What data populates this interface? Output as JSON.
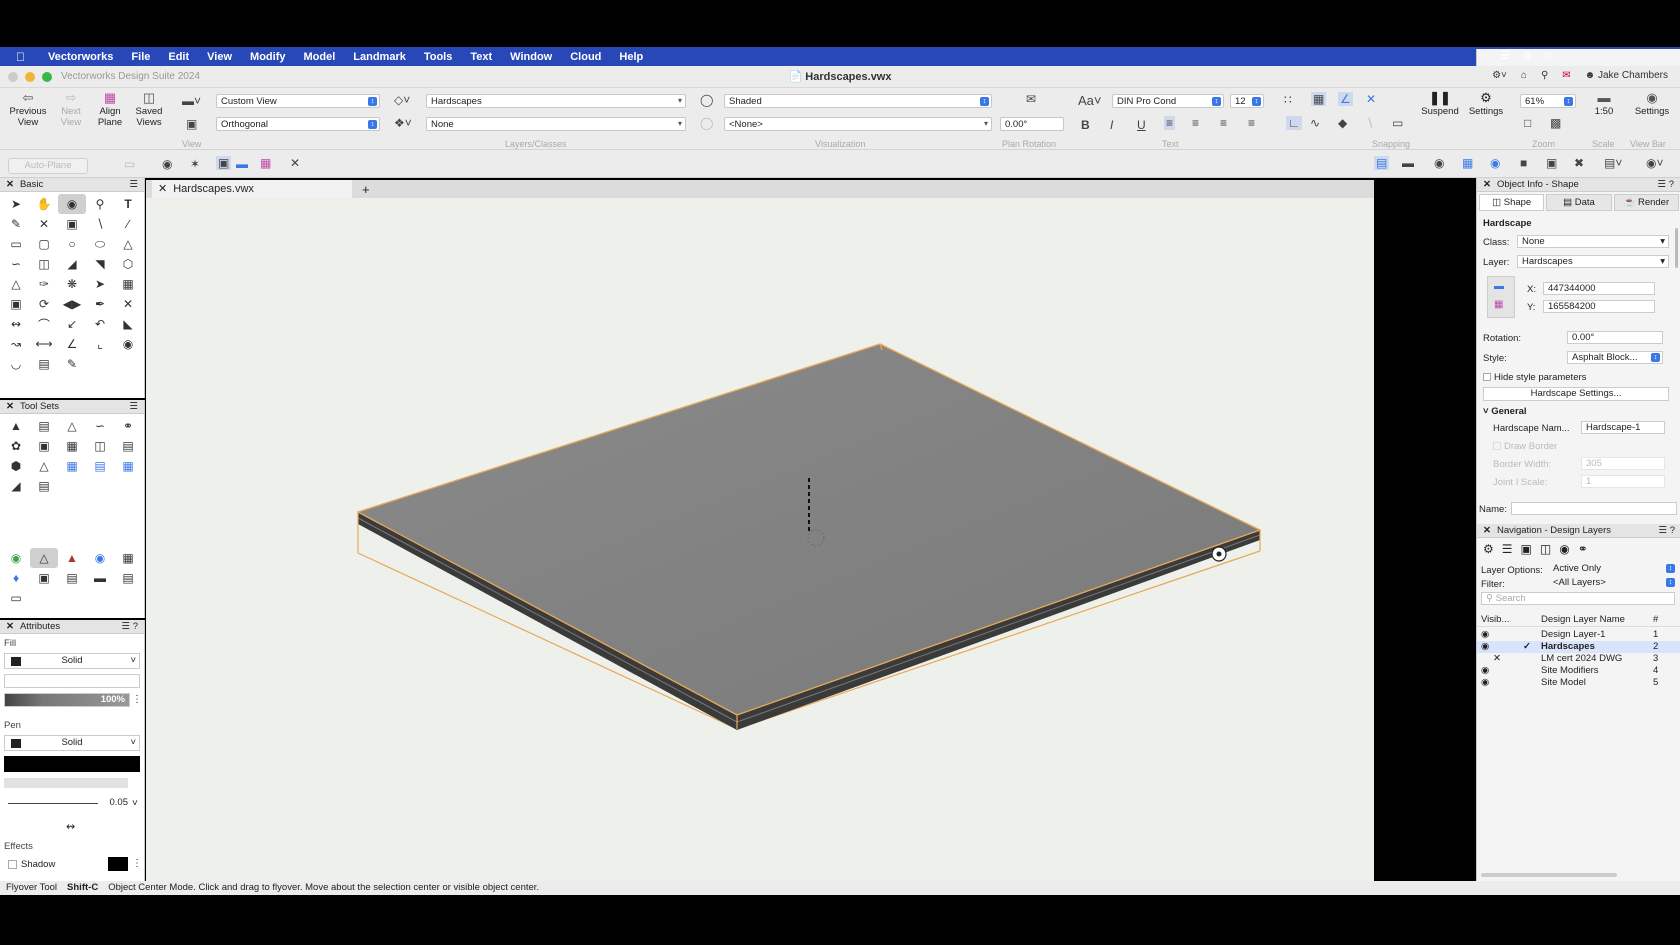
{
  "menubar": {
    "app": "Vectorworks",
    "items": [
      "File",
      "Edit",
      "View",
      "Modify",
      "Model",
      "Landmark",
      "Tools",
      "Text",
      "Window",
      "Cloud",
      "Help"
    ]
  },
  "titlebar": {
    "suite": "Vectorworks Design Suite 2024",
    "document": "Hardscapes.vwx",
    "user": "Jake Chambers"
  },
  "toolbar": {
    "previous_view": "Previous View",
    "next_view": "Next View",
    "align_plane": "Align Plane",
    "saved_views": "Saved Views",
    "view_select": "Custom View",
    "projection_select": "Orthogonal",
    "layer_select": "Hardscapes",
    "class_select": "None",
    "render_select": "Shaded",
    "render_option": "<None>",
    "plan_rotation": "0.00°",
    "font_select": "DIN Pro Cond",
    "font_size": "12",
    "font_aa": "Aa",
    "suspend": "Suspend",
    "settings": "Settings",
    "zoom": "61%",
    "scale": "1:50",
    "viewbar_settings": "Settings",
    "groups": {
      "view": "View",
      "layers_classes": "Layers/Classes",
      "visualization": "Visualization",
      "plan_rotation": "Plan Rotation",
      "text": "Text",
      "snapping": "Snapping",
      "zoom": "Zoom",
      "scale": "Scale",
      "view_bar": "View Bar"
    },
    "auto_plane": "Auto-Plane"
  },
  "basic_palette": {
    "title": "Basic"
  },
  "toolsets_palette": {
    "title": "Tool Sets"
  },
  "attributes": {
    "title": "Attributes",
    "fill_label": "Fill",
    "fill_style": "Solid",
    "opacity": "100%",
    "pen_label": "Pen",
    "pen_style": "Solid",
    "line_weight": "0.05",
    "effects_label": "Effects",
    "shadow_label": "Shadow"
  },
  "document_tab": {
    "label": "Hardscapes.vwx",
    "add": "+"
  },
  "object_info": {
    "title": "Object Info - Shape",
    "tabs": [
      "Shape",
      "Data",
      "Render"
    ],
    "object_type": "Hardscape",
    "class_label": "Class:",
    "class_value": "None",
    "layer_label": "Layer:",
    "layer_value": "Hardscapes",
    "x_label": "X:",
    "x_value": "447344000",
    "y_label": "Y:",
    "y_value": "165584200",
    "rotation_label": "Rotation:",
    "rotation_value": "0.00°",
    "style_label": "Style:",
    "style_value": "Asphalt Block...",
    "hide_style": "Hide style parameters",
    "settings_button": "Hardscape Settings...",
    "general": "General",
    "name_label": "Hardscape Nam...",
    "name_value": "Hardscape-1",
    "draw_border": "Draw Border",
    "border_width_label": "Border Width:",
    "border_width_value": "305",
    "joint_scale_label": "Joint I Scale:",
    "joint_scale_value": "1",
    "name_field_label": "Name:"
  },
  "navigation": {
    "title": "Navigation - Design Layers",
    "layer_options_label": "Layer Options:",
    "layer_options_value": "Active Only",
    "filter_label": "Filter:",
    "filter_value": "<All Layers>",
    "search_placeholder": "Search",
    "col_visibility": "Visib...",
    "col_name": "Design Layer Name",
    "col_number": "#",
    "layers": [
      {
        "name": "Design Layer-1",
        "num": "1"
      },
      {
        "name": "Hardscapes",
        "num": "2"
      },
      {
        "name": "LM cert 2024 DWG",
        "num": "3"
      },
      {
        "name": "Site Modifiers",
        "num": "4"
      },
      {
        "name": "Site Model",
        "num": "5"
      }
    ]
  },
  "status": {
    "tool": "Flyover Tool",
    "shortcut": "Shift-C",
    "message": "Object Center Mode. Click and drag to flyover.  Move about the selection center or visible object center."
  },
  "colors": {
    "menubar": "#2848b8",
    "selection": "#e7a955",
    "accent": "#3a78e8"
  }
}
